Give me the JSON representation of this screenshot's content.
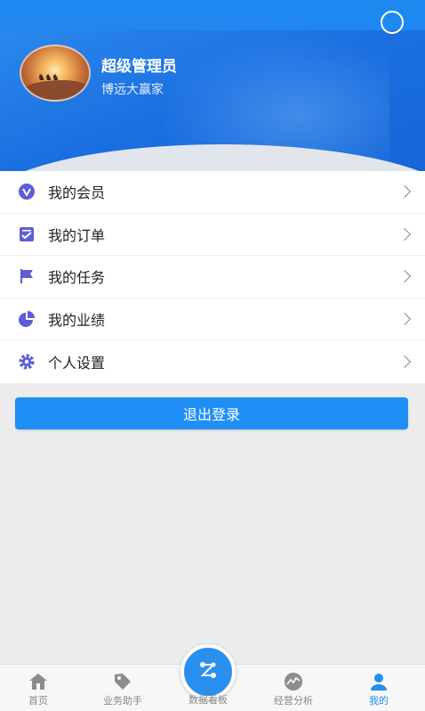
{
  "header": {
    "user_name": "超级管理员",
    "company": "博远大赢家"
  },
  "menu": {
    "items": [
      {
        "label": "我的会员",
        "icon": "vip-icon"
      },
      {
        "label": "我的订单",
        "icon": "order-icon"
      },
      {
        "label": "我的任务",
        "icon": "flag-icon"
      },
      {
        "label": "我的业绩",
        "icon": "pie-chart-icon"
      },
      {
        "label": "个人设置",
        "icon": "gear-icon"
      }
    ]
  },
  "logout_label": "退出登录",
  "tabbar": {
    "home": "首页",
    "assistant": "业务助手",
    "dashboard": "数据看板",
    "analysis": "经营分析",
    "mine": "我的"
  },
  "colors": {
    "accent": "#1f8ef5",
    "icon": "#5b5fd6"
  }
}
